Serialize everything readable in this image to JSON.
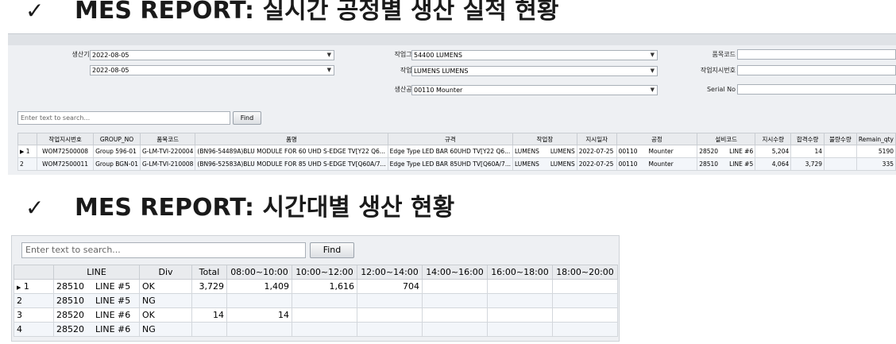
{
  "report1": {
    "check": "✓",
    "title": "MES REPORT: 실시간 공정별 생산 실적 현황",
    "filters": {
      "period_label": "생산기간",
      "date_from": "2022-08-05",
      "date_to": "2022-08-05",
      "workgroup_label": "작업그룹",
      "workgroup_value": "54400   LUMENS",
      "workplace_label": "작업장",
      "workplace_value": "LUMENS   LUMENS",
      "process_label": "생산공정",
      "process_value": "00110   Mounter",
      "itemcode_label": "품목코드",
      "workorder_label": "작업지시번호",
      "serial_label": "Serial No"
    },
    "search": {
      "placeholder": "Enter text to search...",
      "find_label": "Find"
    },
    "grid": {
      "columns": [
        "",
        "작업지시번호",
        "GROUP_NO",
        "품목코드",
        "품명",
        "규격",
        "작업장",
        "지시일자",
        "공정",
        "설비코드",
        "지시수량",
        "합격수량",
        "불량수량",
        "Remain_qty"
      ],
      "rows": [
        {
          "no": "1",
          "wo": "WOM72500008",
          "group": "Group 596-01",
          "item": "G-LM-TVI-220004",
          "name": "(BN96-54489A)BLU MODULE FOR 60 UHD S-EDGE TV[Y22 Q6...",
          "spec": "Edge Type LED BAR 60UHD TV[Y22 Q6...",
          "wp_code": "LUMENS",
          "wp_name": "LUMENS",
          "date": "2022-07-25",
          "proc_code": "00110",
          "proc_name": "Mounter",
          "equip_code": "28520",
          "equip_name": "LINE #6",
          "order_qty": "5,204",
          "pass_qty": "14",
          "ng_qty": "",
          "remain": "5190"
        },
        {
          "no": "2",
          "wo": "WOM72500011",
          "group": "Group BGN-01",
          "item": "G-LM-TVI-210008",
          "name": "(BN96-52583A)BLU MODULE FOR 85 UHD S-EDGE TV[Q60A/7...",
          "spec": "Edge Type LED BAR 85UHD TV[Q60A/7...",
          "wp_code": "LUMENS",
          "wp_name": "LUMENS",
          "date": "2022-07-25",
          "proc_code": "00110",
          "proc_name": "Mounter",
          "equip_code": "28510",
          "equip_name": "LINE #5",
          "order_qty": "4,064",
          "pass_qty": "3,729",
          "ng_qty": "",
          "remain": "335"
        }
      ]
    }
  },
  "report2": {
    "check": "✓",
    "title": "MES REPORT: 시간대별 생산 현황",
    "search": {
      "placeholder": "Enter text to search...",
      "find_label": "Find"
    },
    "grid": {
      "columns": [
        "",
        "LINE",
        "Div",
        "Total",
        "08:00~10:00",
        "10:00~12:00",
        "12:00~14:00",
        "14:00~16:00",
        "16:00~18:00",
        "18:00~20:00"
      ],
      "rows": [
        {
          "no": "1",
          "line_code": "28510",
          "line_name": "LINE #5",
          "div": "OK",
          "total": "3,729",
          "t0810": "1,409",
          "t1012": "1,616",
          "t1214": "704",
          "t1416": "",
          "t1618": "",
          "t1820": ""
        },
        {
          "no": "2",
          "line_code": "28510",
          "line_name": "LINE #5",
          "div": "NG",
          "total": "",
          "t0810": "",
          "t1012": "",
          "t1214": "",
          "t1416": "",
          "t1618": "",
          "t1820": ""
        },
        {
          "no": "3",
          "line_code": "28520",
          "line_name": "LINE #6",
          "div": "OK",
          "total": "14",
          "t0810": "14",
          "t1012": "",
          "t1214": "",
          "t1416": "",
          "t1618": "",
          "t1820": ""
        },
        {
          "no": "4",
          "line_code": "28520",
          "line_name": "LINE #6",
          "div": "NG",
          "total": "",
          "t0810": "",
          "t1012": "",
          "t1214": "",
          "t1416": "",
          "t1618": "",
          "t1820": ""
        }
      ]
    }
  }
}
